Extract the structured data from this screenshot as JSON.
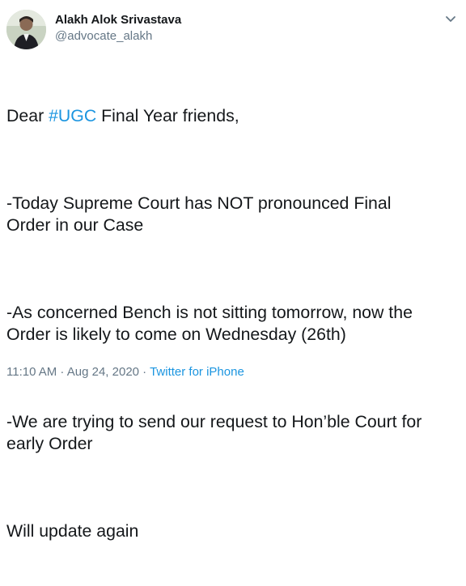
{
  "author": {
    "display_name": "Alakh Alok Srivastava",
    "handle": "@advocate_alakh"
  },
  "tweet": {
    "greeting_prefix": "Dear ",
    "hashtag": "#UGC",
    "greeting_suffix": " Final Year friends,",
    "para_1": "-Today Supreme Court has NOT pronounced Final\nOrder in our Case",
    "para_2": "-As concerned Bench is not sitting tomorrow, now the\nOrder is likely to come on Wednesday (26th)",
    "para_3": "-We are trying to send our request to Hon’ble Court for\nearly Order",
    "para_4": "Will update again"
  },
  "meta": {
    "timestamp": "11:10 AM · Aug 24, 2020",
    "separator": " · ",
    "source": "Twitter for iPhone"
  },
  "colors": {
    "link": "#1b95e0",
    "secondary_text": "#657786",
    "primary_text": "#14171a"
  },
  "icons": {
    "menu": "chevron-down-icon"
  }
}
